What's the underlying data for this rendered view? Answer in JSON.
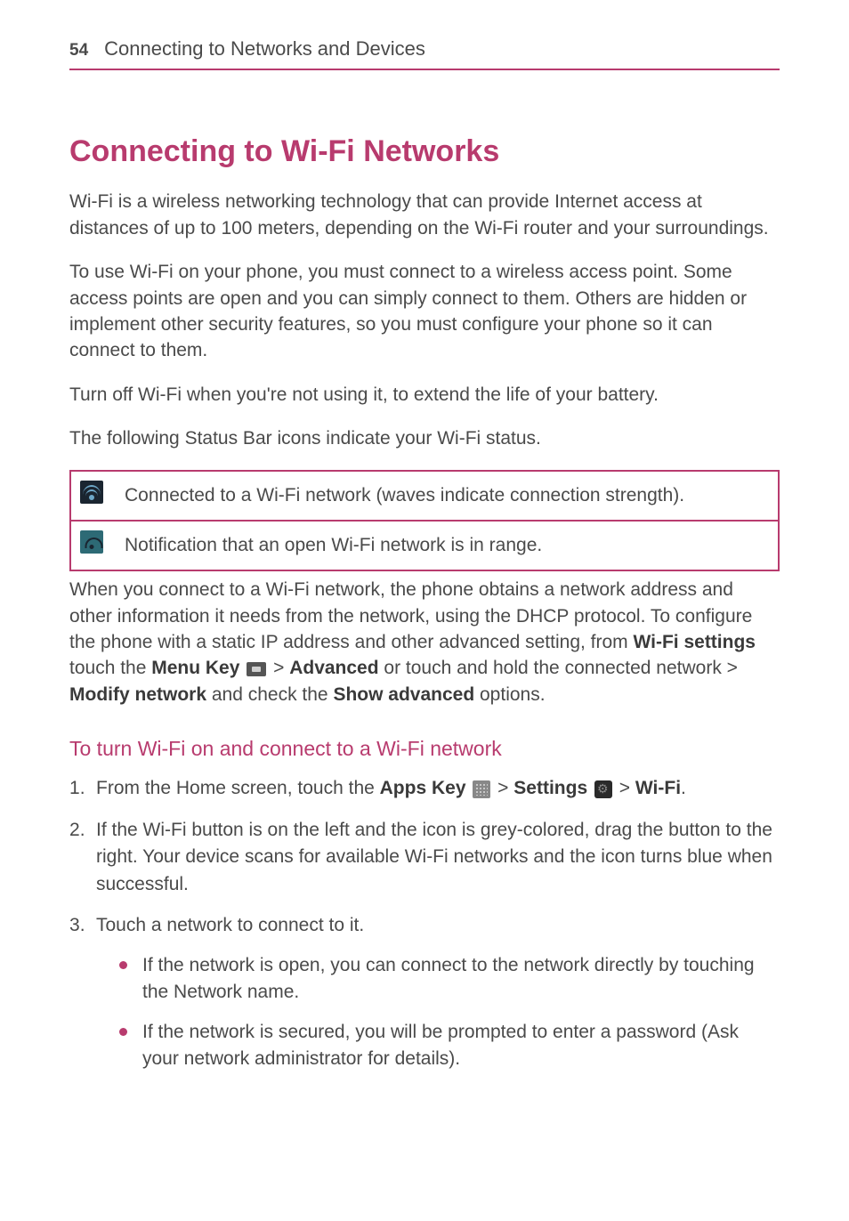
{
  "header": {
    "page_number": "54",
    "section_title": "Connecting to Networks and Devices"
  },
  "main": {
    "heading": "Connecting to Wi-Fi Networks",
    "para1": "Wi-Fi is a wireless networking technology that can provide Internet access at distances of up to 100 meters, depending on the Wi-Fi router and your surroundings.",
    "para2": "To use Wi-Fi on your phone, you must connect to a wireless access point. Some access points are open and you can simply connect to them. Others are hidden or implement other security features, so you must configure your phone so it can connect to them.",
    "para3": "Turn off Wi-Fi when you're not using it, to extend the life of your battery.",
    "para4": "The following Status Bar icons indicate your Wi-Fi status.",
    "icon_rows": [
      {
        "desc": "Connected to a Wi-Fi network (waves indicate connection strength)."
      },
      {
        "desc": "Notification that an open Wi-Fi network is in range."
      }
    ],
    "para5": {
      "t1": "When you connect to a Wi-Fi network, the phone obtains a network address and other information it needs from the network, using the DHCP protocol. To configure the phone with a static IP address and other advanced setting, from ",
      "b1": "Wi-Fi settings",
      "t2": " touch the ",
      "b2": "Menu Key",
      "t3": " > ",
      "b3": "Advanced",
      "t4": " or touch and hold the connected network > ",
      "b4": "Modify network",
      "t5": " and check the ",
      "b5": "Show advanced",
      "t6": " options."
    },
    "sub_heading": "To turn Wi-Fi on and connect to a Wi-Fi network",
    "steps": {
      "s1": {
        "t1": "From the Home screen, touch the ",
        "b1": "Apps Key",
        "t2": " > ",
        "b2": "Settings",
        "t3": " > ",
        "b3": "Wi-Fi",
        "t4": "."
      },
      "s2": "If the Wi-Fi button is on the left and the icon is grey-colored, drag the button to the right. Your device scans for available Wi-Fi networks and the icon turns blue when successful.",
      "s3": {
        "main": "Touch a network to connect to it.",
        "bullets": [
          "If the network is open, you can connect to the network directly by touching the Network name.",
          "If the network is secured, you will be prompted to enter a password (Ask your network administrator for details)."
        ]
      }
    }
  }
}
